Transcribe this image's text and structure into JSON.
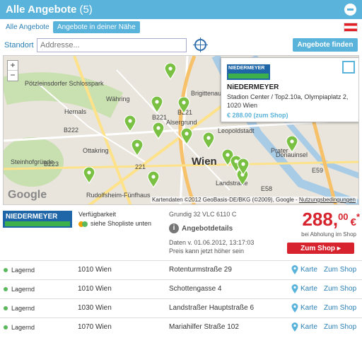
{
  "header": {
    "title": "Alle Angebote",
    "count": "(5)"
  },
  "filters": {
    "all": "Alle Angebote",
    "nearby": "Angebote in deiner Nähe"
  },
  "location": {
    "label": "Standort",
    "placeholder": "Addresse...",
    "value": "",
    "button": "Angebote finden"
  },
  "map": {
    "zoom_in": "+",
    "zoom_out": "−",
    "places": [
      "Pötzleinsdorfer Schlosspark",
      "Währing",
      "Hernals",
      "Ottakring",
      "Steinhofgründe",
      "Rudolfsheim-Fünfhaus",
      "Brigittenau",
      "Alsergrund",
      "Leopoldstadt",
      "Wien",
      "Prater",
      "Landstraße",
      "Donauinsel",
      "B221",
      "B223",
      "B222",
      "221",
      "E59",
      "E58",
      "B221"
    ],
    "google": "Google",
    "attribution": "Kartendaten ©2012 GeoBasis-DE/BKG (©2009), Google - ",
    "attribution_link": "Nutzungsbedingungen",
    "popup": {
      "logo": "NIEDERMEYER",
      "title": "NiEDERMEYER",
      "address": "Stadion Center / Top2.10a, Olympiaplatz 2, 1020 Wien",
      "price": "€ 288.00 (zum Shop)"
    }
  },
  "shop": {
    "logo": "NIEDERMEYER",
    "availability_label": "Verfügbarkeit",
    "availability_status": "siehe Shopliste unten",
    "product": "Grundig 32 VLC 6110 C",
    "details_label": "Angebotdetails",
    "date": "Daten v. 01.06.2012, 13:17:03",
    "price_note": "Preis kann jetzt höher sein",
    "price_int": "288,",
    "price_dec": "00",
    "currency": "€",
    "asterisk": "*",
    "pickup": "bei Abholung im Shop",
    "button": "Zum Shop ▸"
  },
  "stores": [
    {
      "status": "Lagernd",
      "city": "1010 Wien",
      "street": "Rotenturmstraße 29",
      "map": "Karte",
      "shop": "Zum Shop"
    },
    {
      "status": "Lagernd",
      "city": "1010 Wien",
      "street": "Schottengasse 4",
      "map": "Karte",
      "shop": "Zum Shop"
    },
    {
      "status": "Lagernd",
      "city": "1030 Wien",
      "street": "Landstraßer Hauptstraße 6",
      "map": "Karte",
      "shop": "Zum Shop"
    },
    {
      "status": "Lagernd",
      "city": "1070 Wien",
      "street": "Mariahilfer Straße 102",
      "map": "Karte",
      "shop": "Zum Shop"
    }
  ],
  "colors": {
    "accent": "#5ab3da",
    "price": "#d7232d",
    "in_stock": "#5cb85c",
    "pin": "#79c043"
  }
}
